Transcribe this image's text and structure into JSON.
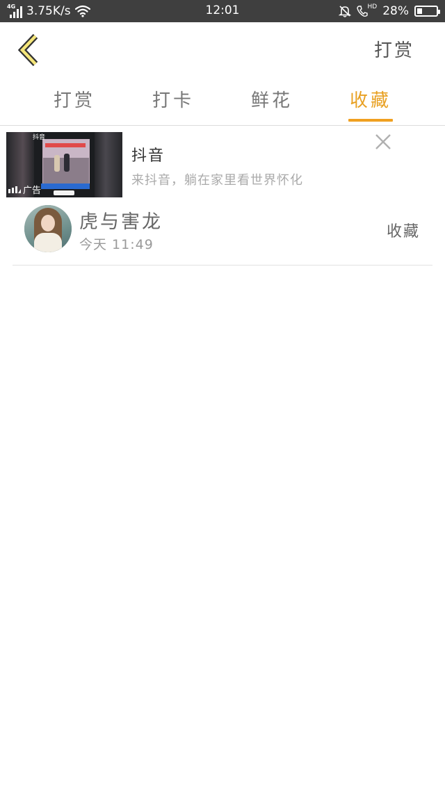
{
  "status_bar": {
    "network": "4G",
    "speed": "3.75K/s",
    "time": "12:01",
    "hd": "HD",
    "battery": "28%",
    "battery_level": 0.28
  },
  "header": {
    "action_label": "打赏"
  },
  "tabs": [
    {
      "label": "打赏",
      "active": false
    },
    {
      "label": "打卡",
      "active": false
    },
    {
      "label": "鲜花",
      "active": false
    },
    {
      "label": "收藏",
      "active": true
    }
  ],
  "ad": {
    "title": "抖音",
    "subtitle": "来抖音，躺在家里看世界怀化",
    "badge": "广告",
    "thumb_brand": "抖音"
  },
  "list": [
    {
      "name": "虎与害龙",
      "time": "今天 11:49",
      "action": "收藏"
    }
  ],
  "colors": {
    "accent": "#f0a020",
    "status_bar": "#3f3f3f",
    "back_icon": "#f5e67a"
  }
}
